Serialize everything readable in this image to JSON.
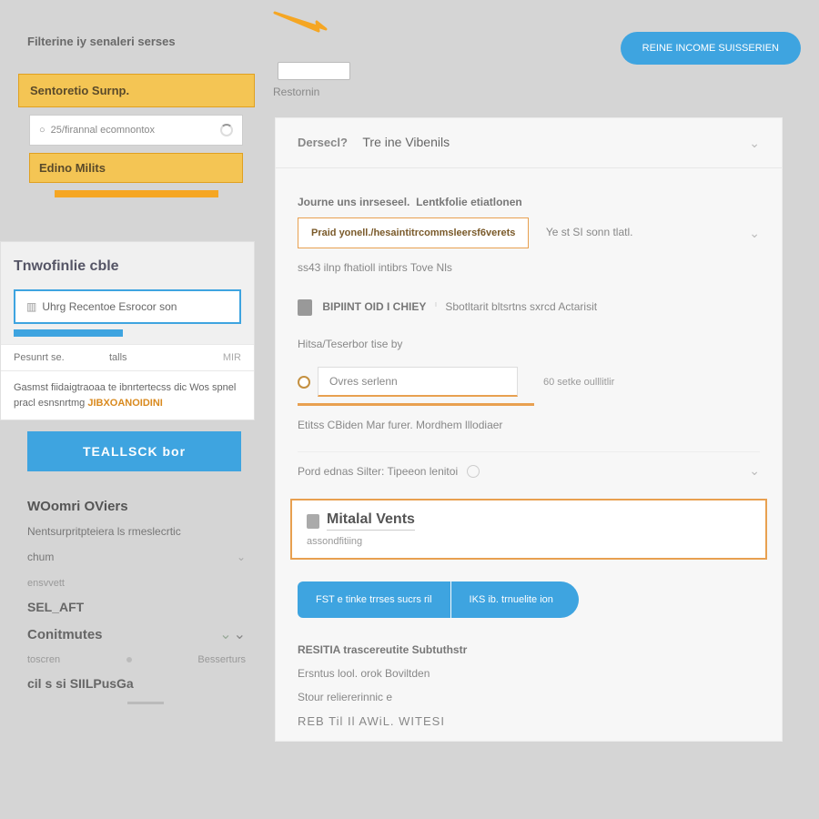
{
  "header": {
    "label": "Filterine iy senaleri serses",
    "sub": "Restornin",
    "button": "REINE INCOME SUISSERIEN"
  },
  "sidebar": {
    "pill1": "Sentoretio Surnp.",
    "search_placeholder": "25/firannal ecomnontox",
    "pill2": "Edino Milits",
    "panel_title": "Tnwofinlie cble",
    "combo": "Uhrg Recentoe Esrocor son",
    "row1_c1": "Pesunrt se.",
    "row1_c2": "talls",
    "row1_c3": "MIR",
    "desc_1": "Gasmst fiidaigtraoaa te ibnrtertecss dic Wos spnel pracl esnsnrtmg",
    "desc_hl": "JIBXOANOIDINI",
    "btn": "TEALLSCK bor",
    "h2": "WOomri OViers",
    "p2": "Nentsurpritpteiera ls rmeslecrtic",
    "dd1": "chum",
    "muted1": "ensvvett",
    "bold1": "SEL_AFT",
    "cont": "Conitmutes",
    "muted2_a": "toscren",
    "muted2_b": "Besserturs",
    "bold2": "cil s si SIILPusGa"
  },
  "main": {
    "card_t1": "Dersecl?",
    "card_t2": "Tre ine Vibenils",
    "sub1a": "Journe uns inrseseel.",
    "sub1b": "Lentkfolie etiatlonen",
    "chip1": "Praid yonell./hesaintitrcommsleersf6verets",
    "exp1": "Ye st SI sonn tlatl.",
    "line1": "ss43 ilnp fhatioll intibrs Tove Nls",
    "line2_a": "BIPIINT OID I CHIEY",
    "line2_b": "Sbotltarit bltsrtns sxrcd Actarisit",
    "sep": "Hitsa/Teserbor tise by",
    "radio_label": "Ovres serlenn",
    "radio_note": "60 setke oulllitlir",
    "line3": "Etitss CBiden Mar furer. Mordhem lllodiaer",
    "dd_label": "Pord ednas Silter: Tipeeon lenitoi",
    "hc_title": "Mitalal Vents",
    "hc_sub": "assondfitiing",
    "pill1": "FST e tinke trrses sucrs ril",
    "pill2": "IKS ib. trnuelite ion",
    "ft1": "RESITIA trascereutite Subtuthstr",
    "ft2": "Ersntus lool. orok Boviltden",
    "ft3": "Stour reliererinnic e",
    "ft4": "REB Til Il AWiL. WITESI"
  }
}
